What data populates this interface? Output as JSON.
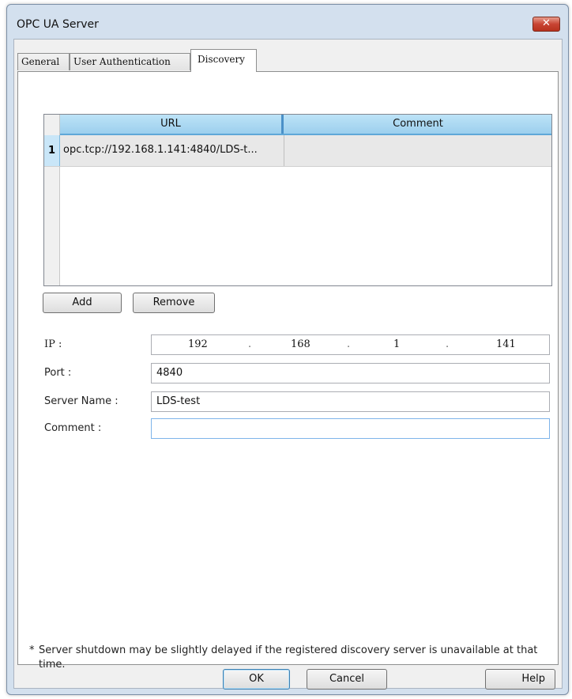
{
  "window": {
    "title": "OPC UA Server",
    "close_glyph": "✕"
  },
  "tabs": [
    {
      "label": "General",
      "active": false
    },
    {
      "label": "User Authentication",
      "active": false
    },
    {
      "label": "Discovery",
      "active": true
    }
  ],
  "grid": {
    "columns": [
      "URL",
      "Comment"
    ],
    "rows": [
      {
        "num": "1",
        "url": "opc.tcp://192.168.1.141:4840/LDS-t...",
        "comment": ""
      }
    ]
  },
  "grid_buttons": {
    "add": "Add",
    "remove": "Remove"
  },
  "form": {
    "ip_label": "IP :",
    "ip": [
      "192",
      "168",
      "1",
      "141"
    ],
    "ip_dot": ".",
    "port_label": "Port :",
    "port": "4840",
    "server_name_label": "Server Name :",
    "server_name": "LDS-test",
    "comment_label": "Comment :",
    "comment": ""
  },
  "note": {
    "bullet": "*",
    "text": "Server shutdown may be slightly delayed if the registered discovery server is unavailable at that time."
  },
  "footer": {
    "ok": "OK",
    "cancel": "Cancel",
    "help": "Help"
  },
  "colors": {
    "grid_header": "#9ccfee",
    "close_button": "#c84433"
  }
}
